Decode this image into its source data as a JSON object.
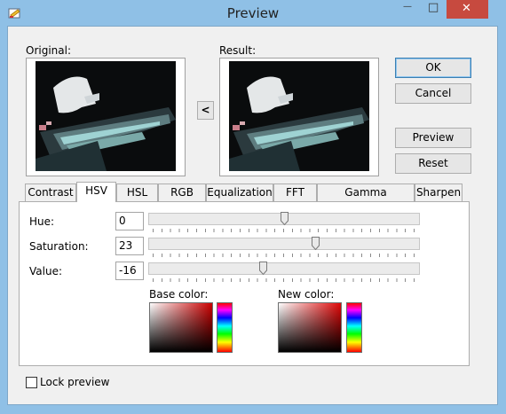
{
  "window": {
    "title": "Preview",
    "close_glyph": "✕",
    "min_glyph": "—",
    "max_glyph": "□"
  },
  "labels": {
    "original": "Original:",
    "result": "Result:",
    "copy_left": "<"
  },
  "buttons": {
    "ok": "OK",
    "cancel": "Cancel",
    "preview": "Preview",
    "reset": "Reset"
  },
  "tabs": [
    "Contrast",
    "HSV",
    "HSL",
    "RGB",
    "Equalization",
    "FFT",
    "Gamma correction",
    "Sharpen"
  ],
  "hsv": {
    "hue_label": "Hue:",
    "hue": "0",
    "hue_level": 0.5,
    "saturation_label": "Saturation:",
    "saturation": "23",
    "saturation_level": 0.615,
    "value_label": "Value:",
    "value": "-16",
    "value_level": 0.42
  },
  "colors": {
    "base_label": "Base color:",
    "new_label": "New color:",
    "base_hex": "#cc0000",
    "new_hex": "#e00808"
  },
  "lock_preview": {
    "label": "Lock preview",
    "checked": false
  },
  "accent": {
    "titlebar": "#8fc0e6",
    "close": "#c74a3f"
  }
}
